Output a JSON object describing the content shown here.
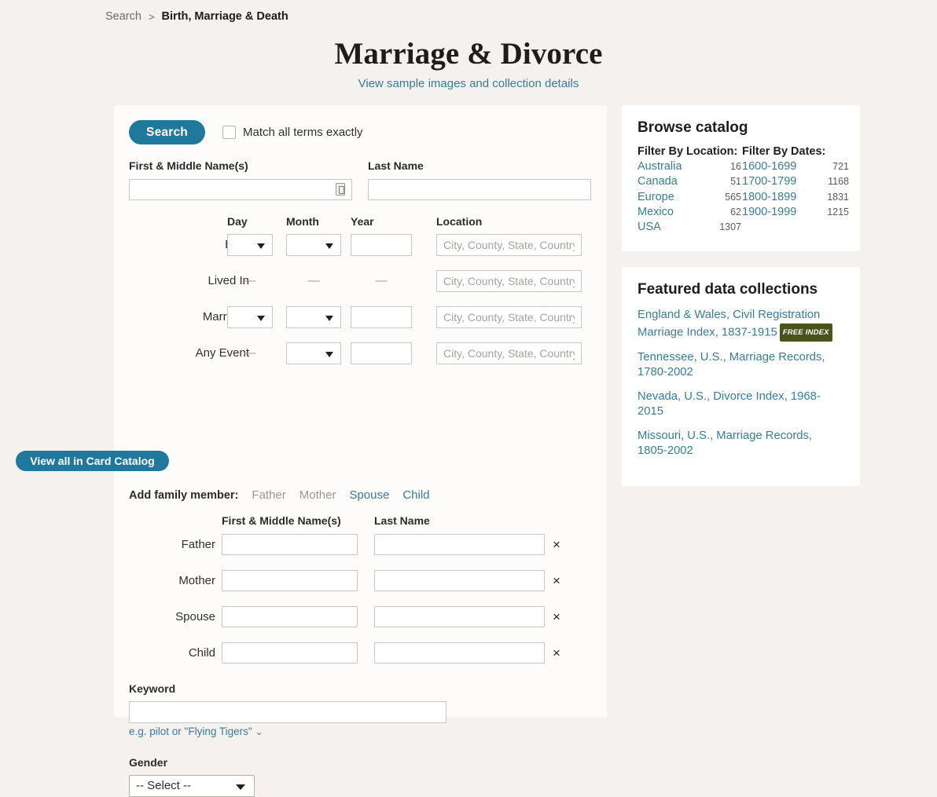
{
  "breadcrumb": {
    "root": "Search",
    "separator": ">",
    "current": "Birth, Marriage & Death"
  },
  "header": {
    "title": "Marriage & Divorce",
    "subtitle_link": "View sample images and collection details"
  },
  "search_form": {
    "search_button": "Search",
    "exact_match_label": "Match all terms exactly",
    "first_name_label": "First & Middle Name(s)",
    "last_name_label": "Last Name",
    "first_name_value": "",
    "last_name_value": "",
    "columns": {
      "day": "Day",
      "month": "Month",
      "year": "Year",
      "location": "Location"
    },
    "location_placeholder": "City, County, State, Country",
    "dash": "—",
    "events": [
      {
        "label": "Birth",
        "day": "select",
        "month": "select",
        "year": "input",
        "location": "input"
      },
      {
        "label": "Lived In",
        "day": "dash",
        "month": "dash",
        "year": "dash",
        "location": "input"
      },
      {
        "label": "Marriage",
        "day": "select",
        "month": "select",
        "year": "input",
        "location": "input"
      },
      {
        "label": "Any Event",
        "day": "dash",
        "month": "select",
        "year": "input",
        "location": "input"
      }
    ],
    "add_family_member_label": "Add family member:",
    "add_family_links": [
      {
        "label": "Father",
        "disabled": true
      },
      {
        "label": "Mother",
        "disabled": true
      },
      {
        "label": "Spouse",
        "disabled": false
      },
      {
        "label": "Child",
        "disabled": false
      }
    ],
    "family_columns": {
      "first": "First & Middle Name(s)",
      "last": "Last Name"
    },
    "family_rows": [
      {
        "label": "Father",
        "first": "",
        "last": "",
        "remove": "×"
      },
      {
        "label": "Mother",
        "first": "",
        "last": "",
        "remove": "×"
      },
      {
        "label": "Spouse",
        "first": "",
        "last": "",
        "remove": "×"
      },
      {
        "label": "Child",
        "first": "",
        "last": "",
        "remove": "×"
      }
    ],
    "keyword_label": "Keyword",
    "keyword_value": "",
    "keyword_hint": "e.g. pilot or \"Flying Tigers\"",
    "keyword_hint_chevron": "⌄",
    "gender_label": "Gender",
    "gender_value": "-- Select --"
  },
  "browse_catalog": {
    "title": "Browse catalog",
    "location_header": "Filter By Location:",
    "dates_header": "Filter By Dates:",
    "locations": [
      {
        "name": "Australia",
        "count": "16"
      },
      {
        "name": "Canada",
        "count": "51"
      },
      {
        "name": "Europe",
        "count": "565"
      },
      {
        "name": "Mexico",
        "count": "62"
      },
      {
        "name": "USA",
        "count": "1307"
      }
    ],
    "dates": [
      {
        "name": "1600-1699",
        "count": "721"
      },
      {
        "name": "1700-1799",
        "count": "1168"
      },
      {
        "name": "1800-1899",
        "count": "1831"
      },
      {
        "name": "1900-1999",
        "count": "1215"
      }
    ]
  },
  "featured": {
    "title": "Featured data collections",
    "items": [
      {
        "text": "England & Wales, Civil Registration Marriage Index, 1837-1915",
        "badge": "FREE INDEX"
      },
      {
        "text": "Tennessee, U.S., Marriage Records, 1780-2002",
        "badge": ""
      },
      {
        "text": "Nevada, U.S., Divorce Index, 1968-2015",
        "badge": ""
      },
      {
        "text": "Missouri, U.S., Marriage Records, 1805-2002",
        "badge": ""
      }
    ],
    "button_label": "View all in Card Catalog"
  },
  "colors": {
    "accent": "#20789c",
    "link": "#3a7b94",
    "badge": "#4b521b",
    "page_bg": "#f4f1ee"
  }
}
